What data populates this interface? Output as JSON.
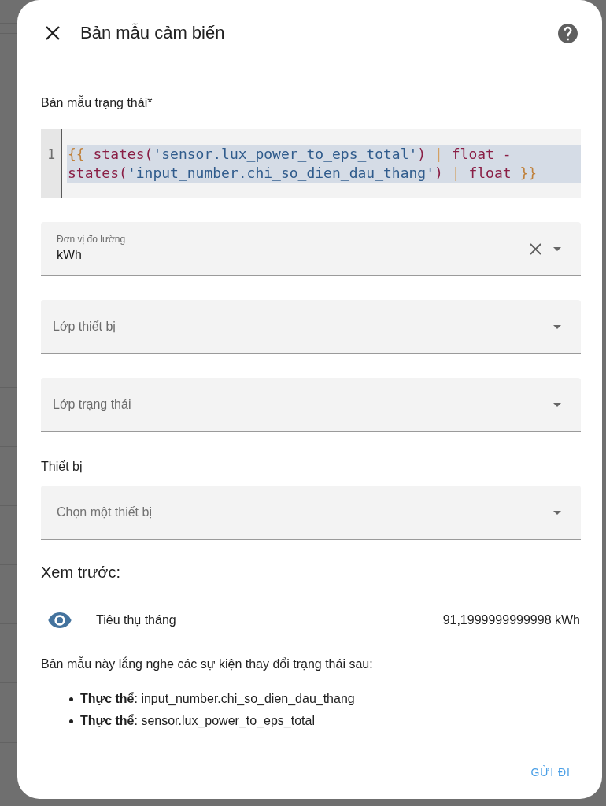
{
  "dialog": {
    "title": "Bản mẫu cảm biến"
  },
  "template": {
    "label": "Bản mẫu trạng thái*",
    "line_number": "1",
    "selected": true,
    "tokens": [
      {
        "kind": "bracket",
        "text": "{{ "
      },
      {
        "kind": "keyword",
        "text": "states"
      },
      {
        "kind": "punct",
        "text": "("
      },
      {
        "kind": "string",
        "text": "'sensor.lux_power_to_eps_total'"
      },
      {
        "kind": "punct",
        "text": ") "
      },
      {
        "kind": "operator",
        "text": "| "
      },
      {
        "kind": "keyword",
        "text": "float "
      },
      {
        "kind": "punct",
        "text": "- "
      },
      {
        "kind": "keyword",
        "text": "states"
      },
      {
        "kind": "punct",
        "text": "("
      },
      {
        "kind": "string",
        "text": "'input_number.chi_so_dien_dau_thang'"
      },
      {
        "kind": "punct",
        "text": ") "
      },
      {
        "kind": "operator",
        "text": "| "
      },
      {
        "kind": "keyword",
        "text": "float "
      },
      {
        "kind": "bracket",
        "text": "}}"
      }
    ]
  },
  "fields": [
    {
      "kind": "value",
      "label": "Đơn vị đo lường",
      "value": "kWh",
      "clearable": true
    },
    {
      "kind": "label",
      "label": "Lớp thiết bị",
      "clearable": false
    },
    {
      "kind": "label",
      "label": "Lớp trạng thái",
      "clearable": false
    }
  ],
  "device": {
    "heading": "Thiết bị",
    "placeholder": "Chọn một thiết bị"
  },
  "preview": {
    "heading": "Xem trước:",
    "entity_name": "Tiêu thụ tháng",
    "state": "91,1999999999998 kWh",
    "note": "Bản mẫu này lắng nghe các sự kiện thay đổi trạng thái sau:",
    "listeners": [
      "**Thực thể**: input_number.chi_so_dien_dau_thang",
      "**Thực thể**: sensor.lux_power_to_eps_total"
    ]
  },
  "actions": [
    "GỬI ĐI"
  ]
}
